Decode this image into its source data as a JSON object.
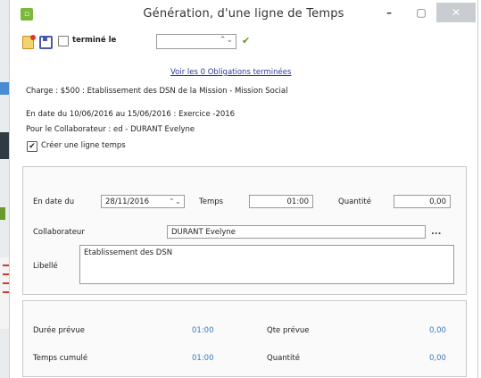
{
  "window": {
    "title": "Génération, d'une ligne de Temps",
    "app_icon": "app-logo-icon",
    "controls": {
      "minimize": "–",
      "maximize": "▢",
      "close": "✕"
    }
  },
  "toolbar": {
    "new_icon": "new-document-icon",
    "save_icon": "save-icon",
    "termine_label": "terminé le",
    "termine_checked": false,
    "termine_date": "",
    "date_spin": "⌃⌄",
    "validate_icon": "checkmark-icon",
    "validate_glyph": "✔"
  },
  "obligations_link": "Voir les 0 Obligations terminées",
  "info": {
    "charge": "Charge : $500 : Etablissement des DSN de la Mission - Mission Social",
    "period": "En date du 10/06/2016 au 15/06/2016 : Exercice -2016",
    "collaborator": "Pour le  Collaborateur : ed - DURANT Evelyne"
  },
  "create_line": {
    "label": "Créer une ligne temps",
    "checked": true,
    "glyph": "✔"
  },
  "form": {
    "date_label": "En date du",
    "date_value": "28/11/2016",
    "date_spin": "⌃⌄",
    "temps_label": "Temps",
    "temps_value": "01:00",
    "quantite_label": "Quantité",
    "quantite_value": "0,00",
    "collaborateur_label": "Collaborateur",
    "collaborateur_value": "DURANT Evelyne",
    "ellipsis": "...",
    "libelle_label": "Libellé",
    "libelle_value": "Etablissement des DSN"
  },
  "summary": {
    "duree_prevue_label": "Durée prévue",
    "duree_prevue_value": "01:00",
    "qte_prevue_label": "Qte prévue",
    "qte_prevue_value": "0,00",
    "temps_cumule_label": "Temps cumulé",
    "temps_cumule_value": "01:00",
    "quantite_label": "Quantité",
    "quantite_value": "0,00"
  },
  "colors": {
    "link": "#2a3a9a",
    "value_blue": "#3a78c2",
    "close_button": "#c9cdd1",
    "accent_green": "#7ab83a"
  }
}
